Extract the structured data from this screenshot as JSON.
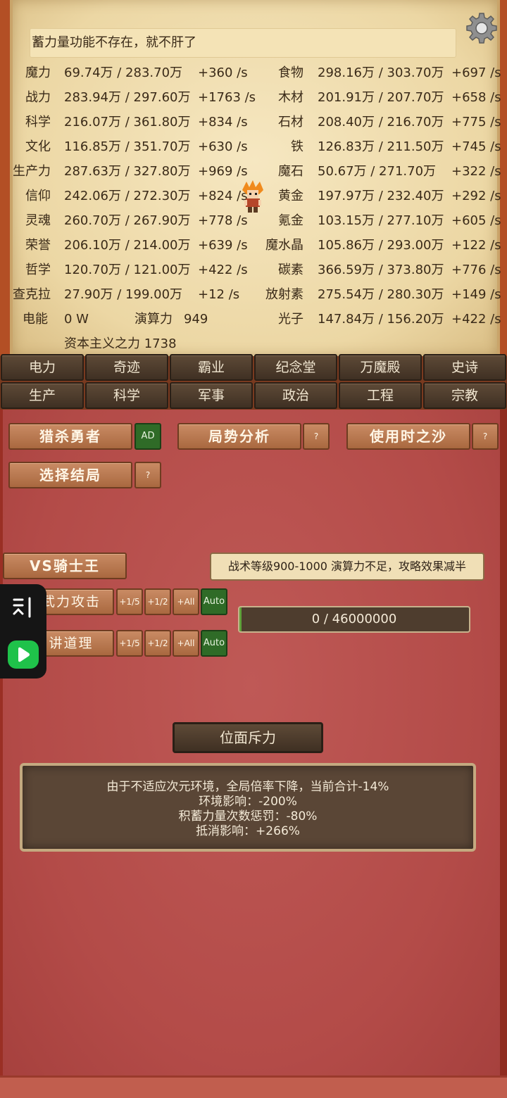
{
  "message": "蓄力量功能不存在，就不肝了",
  "resources_left": [
    {
      "name": "魔力",
      "value": "69.74万 / 283.70万",
      "rate": "+360 /s"
    },
    {
      "name": "战力",
      "value": "283.94万 / 297.60万",
      "rate": "+1763 /s"
    },
    {
      "name": "科学",
      "value": "216.07万 / 361.80万",
      "rate": "+834 /s"
    },
    {
      "name": "文化",
      "value": "116.85万 / 351.70万",
      "rate": "+630 /s"
    },
    {
      "name": "生产力",
      "value": "287.63万 / 327.80万",
      "rate": "+969 /s"
    },
    {
      "name": "信仰",
      "value": "242.06万 / 272.30万",
      "rate": "+824 /s"
    },
    {
      "name": "灵魂",
      "value": "260.70万 / 267.90万",
      "rate": "+778 /s"
    },
    {
      "name": "荣誉",
      "value": "206.10万 / 214.00万",
      "rate": "+639 /s"
    },
    {
      "name": "哲学",
      "value": "120.70万 / 121.00万",
      "rate": "+422 /s"
    },
    {
      "name": "查克拉",
      "value": "27.90万 / 199.00万",
      "rate": "+12 /s"
    }
  ],
  "resources_right": [
    {
      "name": "食物",
      "value": "298.16万 / 303.70万",
      "rate": "+697 /s"
    },
    {
      "name": "木材",
      "value": "201.91万 / 207.70万",
      "rate": "+658 /s"
    },
    {
      "name": "石材",
      "value": "208.40万 / 216.70万",
      "rate": "+775 /s"
    },
    {
      "name": "铁",
      "value": "126.83万 / 211.50万",
      "rate": "+745 /s"
    },
    {
      "name": "魔石",
      "value": "50.67万 / 271.70万",
      "rate": "+322 /s"
    },
    {
      "name": "黄金",
      "value": "197.97万 / 232.40万",
      "rate": "+292 /s"
    },
    {
      "name": "氪金",
      "value": "103.15万 / 277.10万",
      "rate": "+605 /s"
    },
    {
      "name": "魔水晶",
      "value": "105.86万 / 293.00万",
      "rate": "+122 /s"
    },
    {
      "name": "碳素",
      "value": "366.59万 / 373.80万",
      "rate": "+776 /s"
    },
    {
      "name": "放射素",
      "value": "275.54万 / 280.30万",
      "rate": "+149 /s"
    },
    {
      "name": "光子",
      "value": "147.84万 / 156.20万",
      "rate": "+422 /s"
    }
  ],
  "power": {
    "name": "电能",
    "value": "0 W"
  },
  "compute": {
    "name": "演算力",
    "value": "949"
  },
  "capitalism": "资本主义之力 1738",
  "tabs_row1": [
    "电力",
    "奇迹",
    "霸业",
    "纪念堂",
    "万魔殿",
    "史诗"
  ],
  "tabs_row2": [
    "生产",
    "科学",
    "军事",
    "政治",
    "工程",
    "宗教"
  ],
  "actions": {
    "hunt_hero": "猎杀勇者",
    "ad": "AD",
    "analysis": "局势分析",
    "sand": "使用时之沙",
    "ending": "选择结局",
    "question": "?"
  },
  "battle": {
    "title": "VS骑士王",
    "note": "战术等级900-1000 演算力不足，攻略效果减半",
    "attack": "武力攻击",
    "reason": "讲道理",
    "step_fifth": "+1/5",
    "step_half": "+1/2",
    "step_all": "+All",
    "auto": "Auto",
    "progress_text": "0 / 46000000",
    "progress_fraction": 0.0
  },
  "repulsion_button": "位面斥力",
  "info_lines": [
    "由于不适应次元环境，全局倍率下降，当前合计-14%",
    "环境影响：-200%",
    "积蓄力量次数惩罚：-80%",
    "抵消影响：+266%"
  ],
  "colors": {
    "parchment": "#f0dfb2",
    "red_panel": "#b8504d",
    "tab_dark": "#4a3a2b",
    "auto_green": "#2f6b27",
    "overlay_green": "#1fc24a"
  }
}
